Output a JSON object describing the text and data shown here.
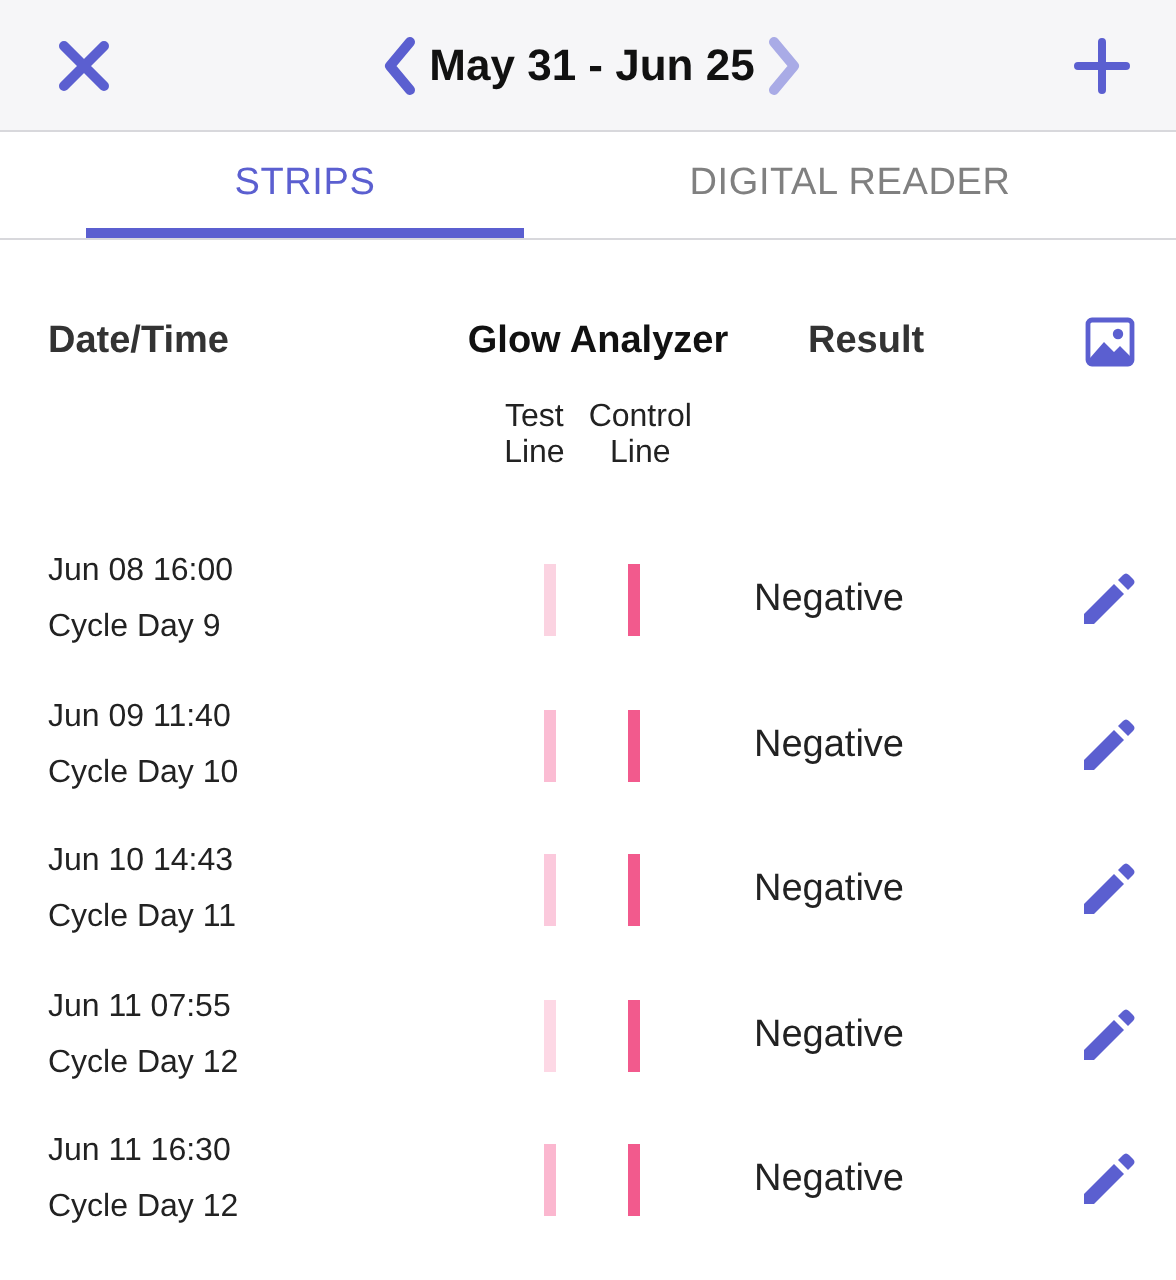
{
  "header": {
    "title": "May 31 - Jun 25",
    "next_enabled": false
  },
  "tabs": [
    {
      "label": "STRIPS",
      "selected": true
    },
    {
      "label": "DIGITAL READER",
      "selected": false
    }
  ],
  "table": {
    "columns": {
      "date": "Date/Time",
      "analyzer": "Glow Analyzer",
      "result": "Result"
    },
    "sub_columns": [
      "Test Line",
      "Control Line"
    ],
    "rows": [
      {
        "date": "Jun 08 16:00",
        "cycle_day": "Cycle Day 9",
        "test_line": {
          "color": "#fbd3e1"
        },
        "control_line": {
          "color": "#f25a8d"
        },
        "result": "Negative"
      },
      {
        "date": "Jun 09 11:40",
        "cycle_day": "Cycle Day 10",
        "test_line": {
          "color": "#fbbcd3"
        },
        "control_line": {
          "color": "#f25a8d"
        },
        "result": "Negative"
      },
      {
        "date": "Jun 10 14:43",
        "cycle_day": "Cycle Day 11",
        "test_line": {
          "color": "#fbc9dc"
        },
        "control_line": {
          "color": "#f25a8d"
        },
        "result": "Negative"
      },
      {
        "date": "Jun 11 07:55",
        "cycle_day": "Cycle Day 12",
        "test_line": {
          "color": "#fdd8e5"
        },
        "control_line": {
          "color": "#f25a8d"
        },
        "result": "Negative"
      },
      {
        "date": "Jun 11 16:30",
        "cycle_day": "Cycle Day 12",
        "test_line": {
          "color": "#fbb7cf"
        },
        "control_line": {
          "color": "#f25a8d"
        },
        "result": "Negative"
      }
    ]
  }
}
